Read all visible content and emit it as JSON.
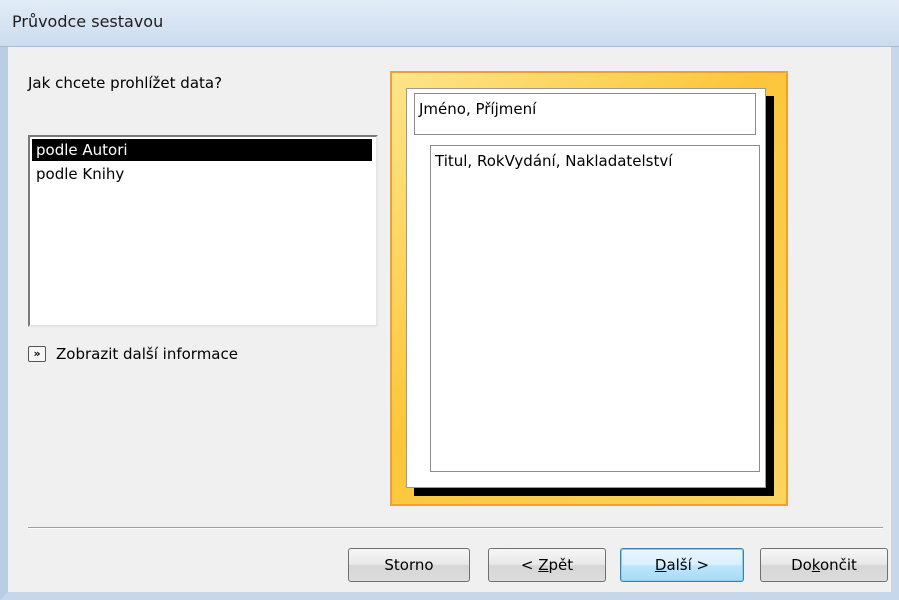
{
  "window": {
    "title": "Průvodce sestavou"
  },
  "prompt": {
    "question": "Jak chcete prohlížet data?"
  },
  "list": {
    "items": [
      {
        "label": "podle Autori",
        "selected": true
      },
      {
        "label": "podle Knihy",
        "selected": false
      }
    ]
  },
  "more_info": {
    "label": "Zobrazit další informace",
    "icon": "double-chevron-right-icon"
  },
  "preview": {
    "header_fields": "Jméno, Příjmení",
    "detail_fields": "Titul, RokVydání, Nakladatelství"
  },
  "buttons": {
    "cancel": "Storno",
    "back_prefix": "< ",
    "back_mnemonic": "Z",
    "back_rest": "pět",
    "next_prefix": "",
    "next_mnemonic": "D",
    "next_rest": "alší >",
    "finish_prefix": "Do",
    "finish_mnemonic": "k",
    "finish_rest": "ončit"
  },
  "colors": {
    "selection": "#000000",
    "preview_border": "#f0a030",
    "preview_fill": "#fbc63a",
    "default_button": "#bee6fd"
  }
}
